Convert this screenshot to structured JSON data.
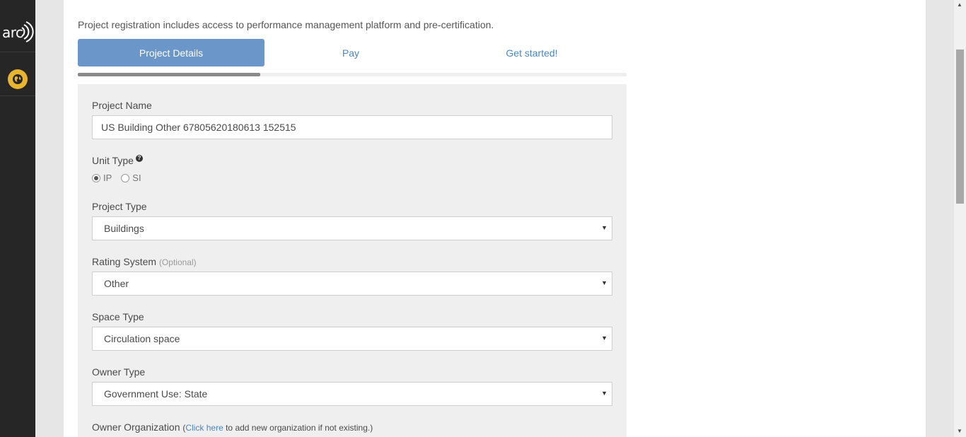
{
  "sidebar": {
    "logo_text": "arc",
    "icons": [
      "arc-logo-icon",
      "globe-icon"
    ]
  },
  "intro": "Project registration includes access to performance management platform and pre-certification.",
  "tabs": {
    "details": "Project Details",
    "pay": "Pay",
    "start": "Get started!"
  },
  "progress_fraction": 0.333,
  "form": {
    "project_name": {
      "label": "Project Name",
      "value": "US Building Other 67805620180613 152515"
    },
    "unit_type": {
      "label": "Unit Type",
      "help": "?",
      "options": [
        "IP",
        "SI"
      ],
      "selected": "IP"
    },
    "project_type": {
      "label": "Project Type",
      "value": "Buildings"
    },
    "rating_system": {
      "label": "Rating System",
      "optional": "(Optional)",
      "value": "Other"
    },
    "space_type": {
      "label": "Space Type",
      "value": "Circulation space"
    },
    "owner_type": {
      "label": "Owner Type",
      "value": "Government Use: State"
    },
    "owner_org": {
      "label": "Owner Organization",
      "paren_open": "(",
      "link": "Click here",
      "suffix": " to add new organization if not existing.)"
    }
  },
  "colors": {
    "sidebar": "#262626",
    "accent": "#6b96c9",
    "link": "#4a86c5",
    "logo_badge": "#e8b52f"
  }
}
